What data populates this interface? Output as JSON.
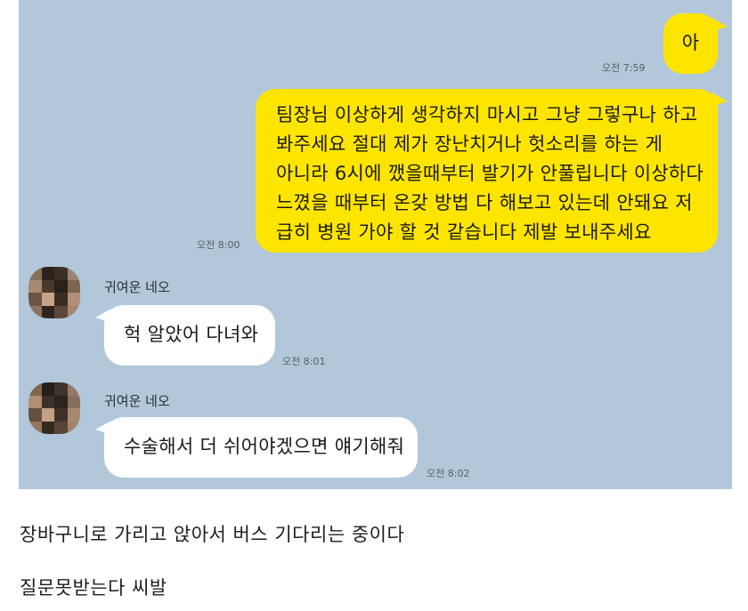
{
  "chat": {
    "messages": [
      {
        "sender": "me",
        "text": "아",
        "time": "오전 7:59"
      },
      {
        "sender": "me",
        "text": "팀장님 이상하게 생각하지 마시고 그냥 그렇구나 하고\n봐주세요 절대 제가 장난치거나 헛소리를 하는 게\n아니라 6시에 깼을때부터 발기가 안풀립니다 이상하다\n느꼈을 때부터 온갖 방법 다 해보고 있는데 안돼요 저\n급히 병원 가야 할 것 같습니다 제발 보내주세요",
        "time": "오전 8:00"
      },
      {
        "sender": "other",
        "name": "귀여운 네오",
        "text": "헉 알았어 다녀와",
        "time": "오전 8:01"
      },
      {
        "sender": "other",
        "name": "귀여운 네오",
        "text": "수술해서 더 쉬어야겠으면 얘기해줘",
        "time": "오전 8:02"
      }
    ]
  },
  "captions": [
    "장바구니로 가리고 앉아서 버스 기다리는 중이다",
    "질문못받는다 씨발"
  ],
  "colors": {
    "chat_background": "#b2c7da",
    "my_bubble": "#fee500",
    "other_bubble": "#ffffff"
  }
}
